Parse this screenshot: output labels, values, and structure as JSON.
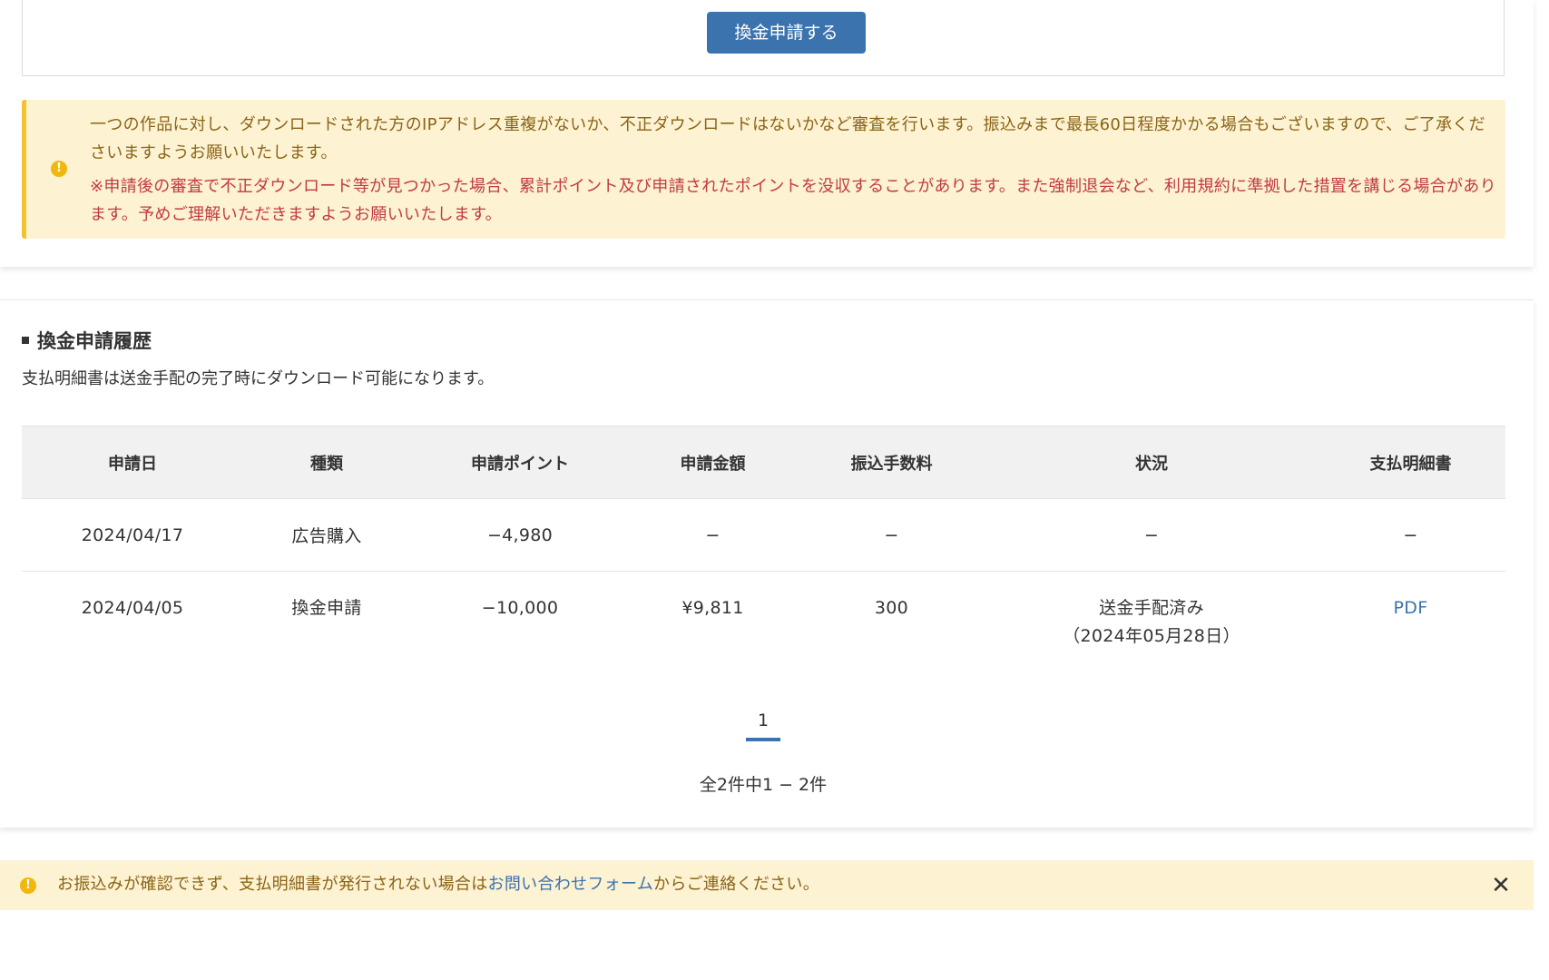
{
  "apply_form": {
    "submit_label": "換金申請する"
  },
  "warning": {
    "icon": "exclamation-circle-icon",
    "message": "一つの作品に対し、ダウンロードされた方のIPアドレス重複がないか、不正ダウンロードはないかなど審査を行います。振込みまで最長60日程度かかる場合もございますので、ご了承くださいますようお願いいたします。",
    "caution": "※申請後の審査で不正ダウンロード等が見つかった場合、累計ポイント及び申請されたポイントを没収することがあります。また強制退会など、利用規約に準拠した措置を講じる場合があります。予めご理解いただきますようお願いいたします。"
  },
  "history": {
    "title": "換金申請履歴",
    "note": "支払明細書は送金手配の完了時にダウンロード可能になります。",
    "columns": {
      "date": "申請日",
      "type": "種類",
      "points": "申請ポイント",
      "amount": "申請金額",
      "fee": "振込手数料",
      "status": "状況",
      "statement": "支払明細書"
    },
    "rows": [
      {
        "date": "2024/04/17",
        "type": "広告購入",
        "points": "−4,980",
        "amount": "−",
        "fee": "−",
        "status": "−",
        "status_detail": "",
        "statement": "−"
      },
      {
        "date": "2024/04/05",
        "type": "換金申請",
        "points": "−10,000",
        "amount": "¥9,811",
        "fee": "300",
        "status": "送金手配済み",
        "status_detail": "（2024年05月28日）",
        "statement": "PDF"
      }
    ]
  },
  "pagination": {
    "current_page": "1",
    "summary": "全2件中1 − 2件"
  },
  "notice": {
    "icon": "exclamation-circle-icon",
    "text_before": "お振込みが確認できず、支払明細書が発行されない場合は",
    "link_text": "お問い合わせフォーム",
    "text_after": "からご連絡ください。",
    "close_icon": "close-icon"
  },
  "colors": {
    "accent": "#3a73ad",
    "warning_bg": "#fdf2d2",
    "warning_border": "#f2c230",
    "warning_text": "#8a6417",
    "alert_red": "#c23a45"
  }
}
